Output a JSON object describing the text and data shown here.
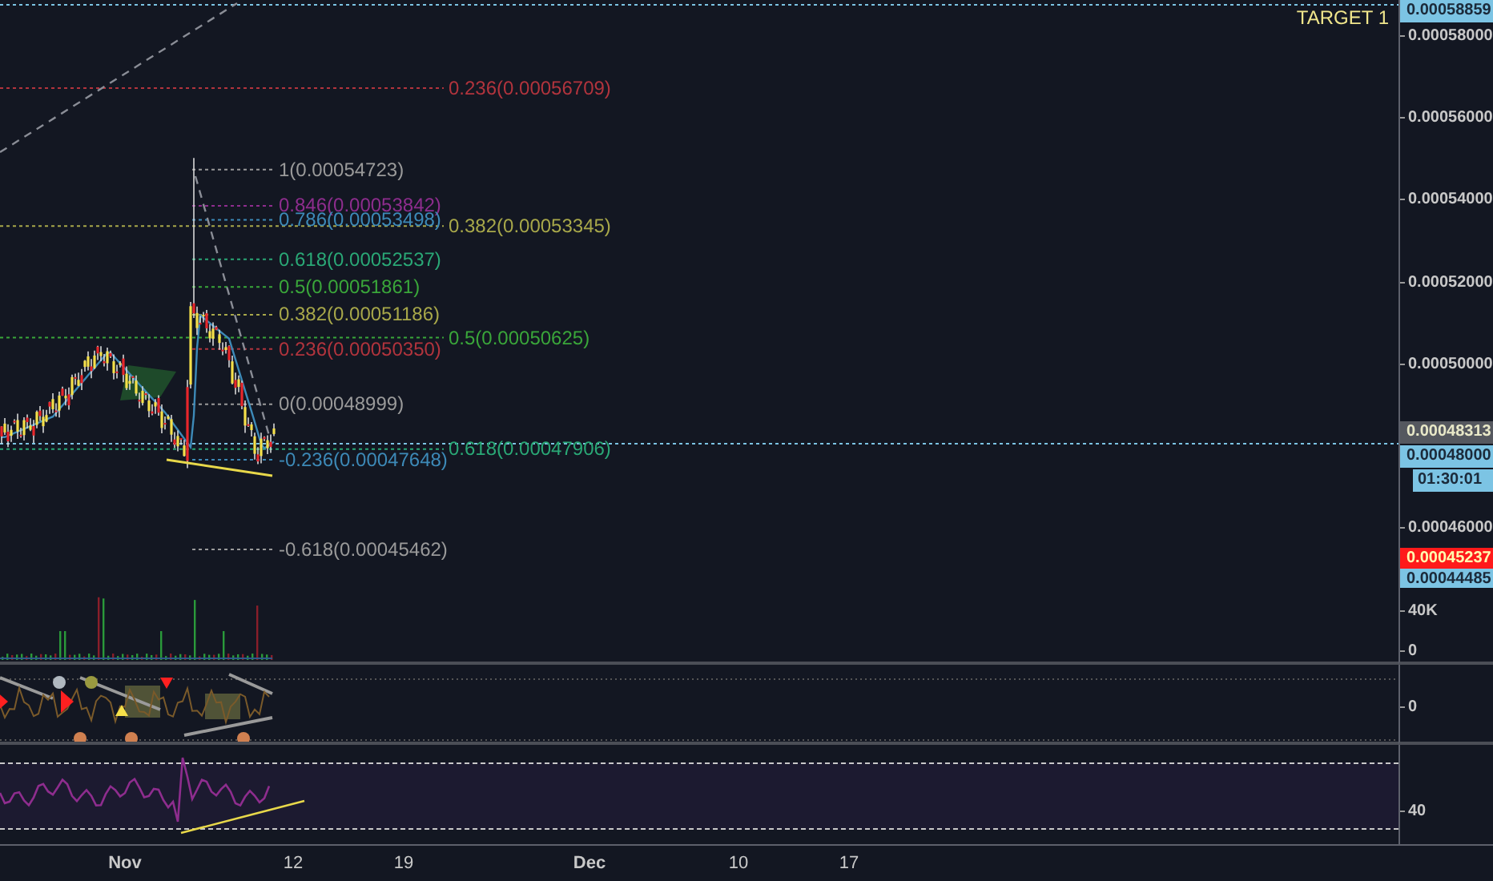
{
  "chart": {
    "marker_text": "TARGET 1",
    "fib_levels": [
      {
        "text": "0.236(0.00056709)",
        "color": "#b2343d",
        "kind": "outer"
      },
      {
        "text": "1(0.00054723)",
        "color": "#9a9a9a",
        "kind": "inner"
      },
      {
        "text": "0.846(0.00053842)",
        "color": "#8e2d8e",
        "kind": "inner"
      },
      {
        "text": "0.786(0.00053498)",
        "color": "#3d8ab8",
        "kind": "inner"
      },
      {
        "text": "0.382(0.00053345)",
        "color": "#a8a84a",
        "kind": "outer"
      },
      {
        "text": "0.618(0.00052537)",
        "color": "#2aa876",
        "kind": "inner"
      },
      {
        "text": "0.5(0.00051861)",
        "color": "#3aa63a",
        "kind": "inner"
      },
      {
        "text": "0.382(0.00051186)",
        "color": "#a8a84a",
        "kind": "inner"
      },
      {
        "text": "0.236(0.00050350)",
        "color": "#b2343d",
        "kind": "inner"
      },
      {
        "text": "0.5(0.00050625)",
        "color": "#3aa63a",
        "kind": "outer"
      },
      {
        "text": "0(0.00048999)",
        "color": "#9a9a9a",
        "kind": "inner"
      },
      {
        "text": "0.618(0.00047906)",
        "color": "#2aa876",
        "kind": "outer"
      },
      {
        "text": "-0.236(0.00047648)",
        "color": "#3d8ab8",
        "kind": "inner"
      },
      {
        "text": "-0.618(0.00045462)",
        "color": "#9a9a9a",
        "kind": "inner"
      }
    ],
    "price_ticks": [
      "0.00058000",
      "0.00056000",
      "0.00054000",
      "0.00052000",
      "0.00050000",
      "0.00046000"
    ],
    "price_tags": [
      {
        "text": "0.00058859",
        "kind": "line"
      },
      {
        "text": "0.00048313",
        "kind": "last"
      },
      {
        "text": "0.00048000",
        "kind": "line"
      },
      {
        "text": "01:30:01",
        "kind": "timer"
      },
      {
        "text": "0.00045237",
        "kind": "low"
      },
      {
        "text": "0.00044485",
        "kind": "line"
      }
    ]
  },
  "volume_panel": {
    "ticks": [
      "40K",
      "0"
    ]
  },
  "oscillator_panel": {
    "ticks": [
      "0"
    ]
  },
  "rsi_panel": {
    "ticks": [
      "40"
    ]
  },
  "time_axis": [
    {
      "text": "Nov",
      "bold": true
    },
    {
      "text": "12",
      "bold": false
    },
    {
      "text": "19",
      "bold": false
    },
    {
      "text": "Dec",
      "bold": true
    },
    {
      "text": "10",
      "bold": false
    },
    {
      "text": "17",
      "bold": false
    }
  ]
}
